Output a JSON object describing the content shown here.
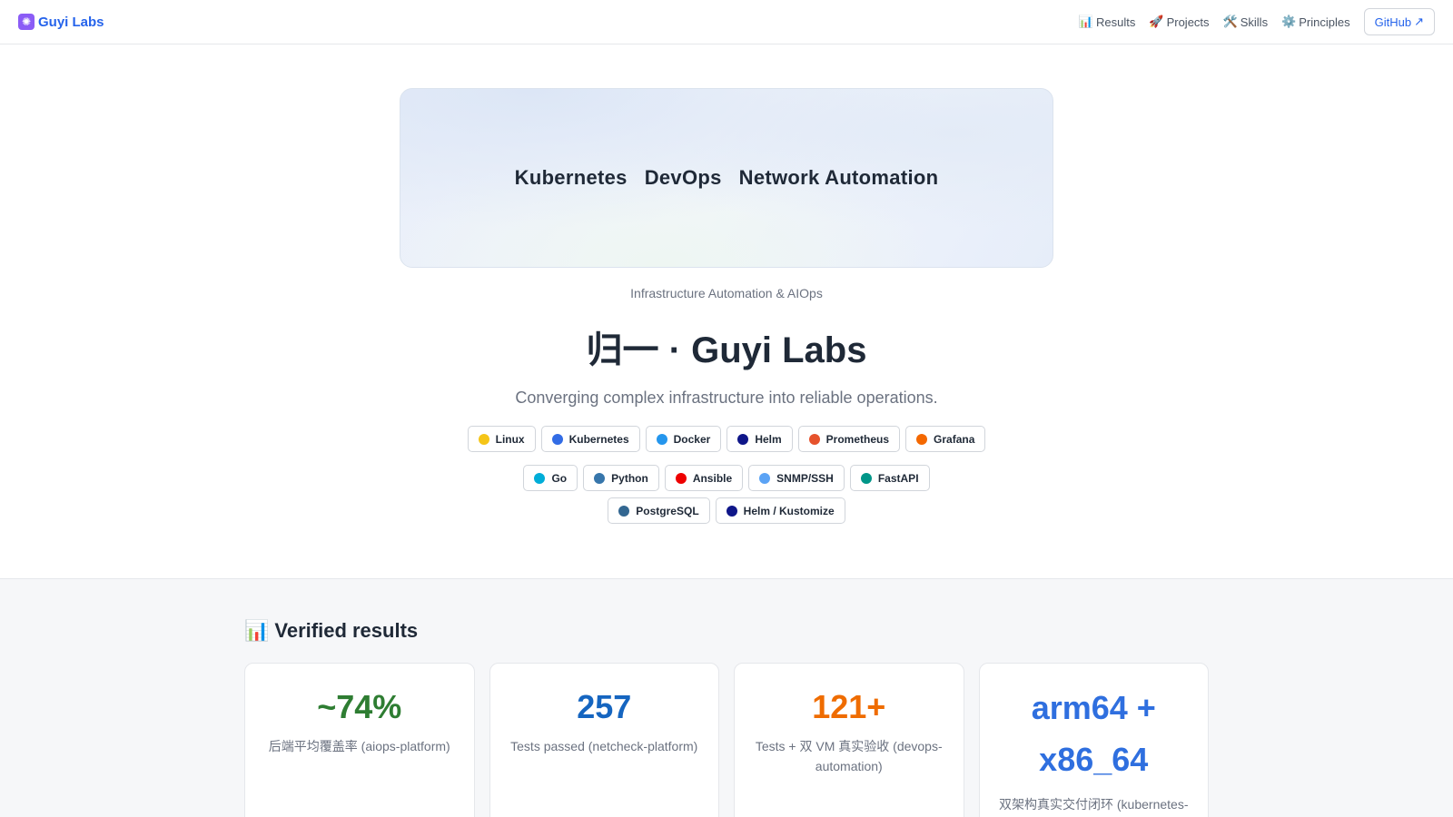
{
  "brand": {
    "name": "Guyi Labs",
    "logo_icon": "atom-icon"
  },
  "nav": {
    "items": [
      {
        "icon": "📊",
        "label": "Results"
      },
      {
        "icon": "🚀",
        "label": "Projects"
      },
      {
        "icon": "🛠️",
        "label": "Skills"
      },
      {
        "icon": "⚙️",
        "label": "Principles"
      }
    ],
    "github_label": "GitHub",
    "github_icon": "↗"
  },
  "hero": {
    "banner_words": [
      "Kubernetes",
      "DevOps",
      "Network Automation"
    ],
    "tagline": "Infrastructure Automation & AIOps",
    "title": "归一 · Guyi Labs",
    "subtitle": "Converging complex infrastructure into reliable operations."
  },
  "tags": {
    "row1": [
      {
        "label": "Linux",
        "color": "#f5c518"
      },
      {
        "label": "Kubernetes",
        "color": "#326ce5"
      },
      {
        "label": "Docker",
        "color": "#2496ed"
      },
      {
        "label": "Helm",
        "color": "#0f1689"
      },
      {
        "label": "Prometheus",
        "color": "#e6522c"
      },
      {
        "label": "Grafana",
        "color": "#f46800"
      }
    ],
    "row2": [
      {
        "label": "Go",
        "color": "#00add8"
      },
      {
        "label": "Python",
        "color": "#3776ab"
      },
      {
        "label": "Ansible",
        "color": "#ee0000"
      },
      {
        "label": "SNMP/SSH",
        "color": "#5ba3f5"
      },
      {
        "label": "FastAPI",
        "color": "#009688"
      },
      {
        "label": "PostgreSQL",
        "color": "#336791"
      },
      {
        "label": "Helm / Kustomize",
        "color": "#0f1689"
      }
    ]
  },
  "results": {
    "icon": "📊",
    "title": "Verified results",
    "cards": [
      {
        "value": "~74%",
        "label": "后端平均覆盖率 (aiops-platform)",
        "color": "#2e7d32"
      },
      {
        "value": "257",
        "label": "Tests passed (netcheck-platform)",
        "color": "#1565c0"
      },
      {
        "value": "121+",
        "label": "Tests + 双 VM 真实验收 (devops-automation)",
        "color": "#ef6c00"
      },
      {
        "value": "arm64 + x86_64",
        "label": "双架构真实交付闭环 (kubernetes-cluster-bootstrap)",
        "color": "#2f6fdf"
      }
    ]
  }
}
